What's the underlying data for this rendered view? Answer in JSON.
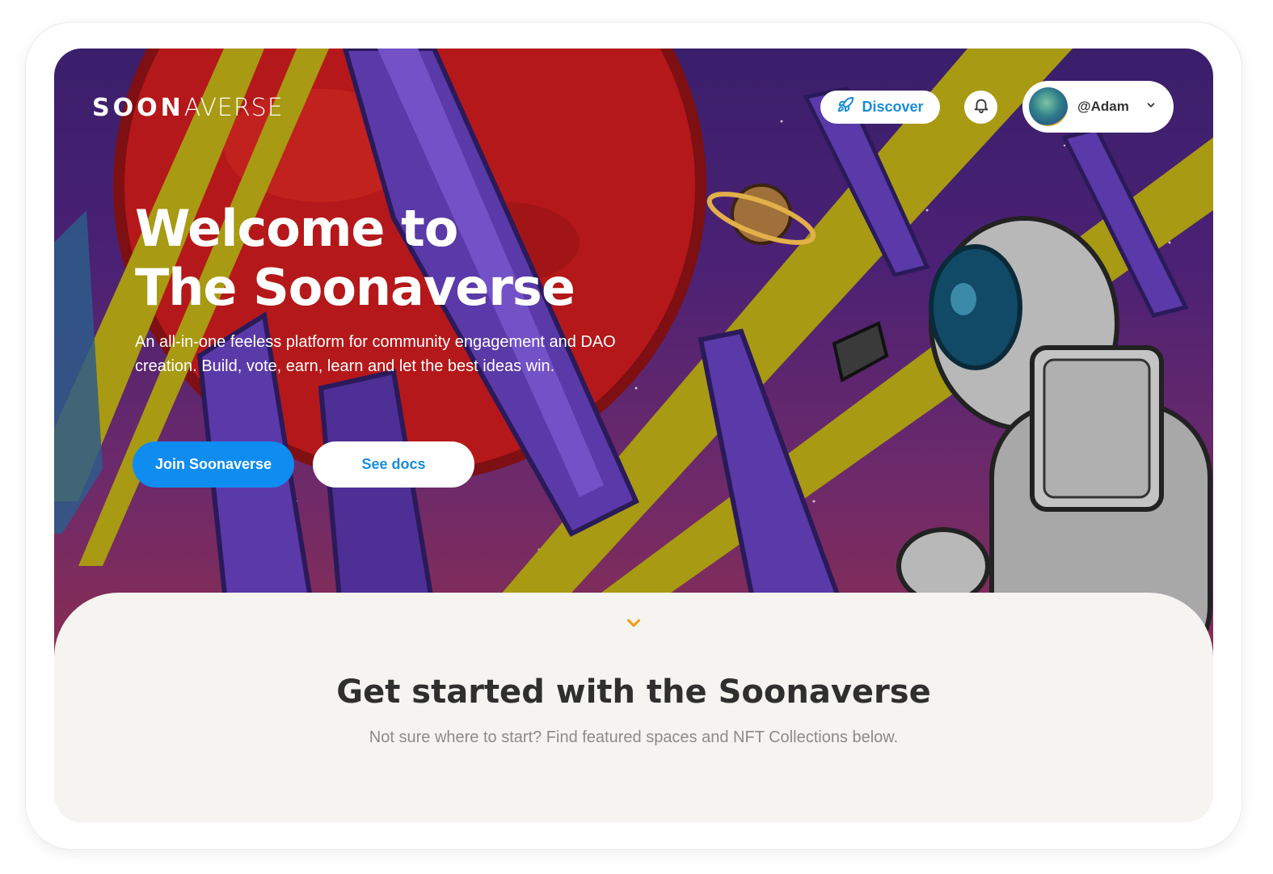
{
  "header": {
    "logo_bold": "SOON",
    "logo_thin": "AVERSE",
    "discover_label": "Discover",
    "username": "@Adam"
  },
  "hero": {
    "title_line1": "Welcome to",
    "title_line2": "The Soonaverse",
    "description": "An all-in-one feeless platform for community engagement and DAO creation. Build, vote, earn, learn and let the best ideas win.",
    "primary_button": "Join Soonaverse",
    "secondary_button": "See docs"
  },
  "section": {
    "title": "Get started with the Soonaverse",
    "subtitle": "Not sure where to start? Find featured spaces and NFT Collections below."
  },
  "icons": {
    "discover": "rocket-icon",
    "notifications": "bell-icon",
    "dropdown": "chevron-down-icon",
    "scroll": "chevron-down-icon"
  },
  "colors": {
    "accent_blue": "#0f8cf0",
    "link_blue": "#1a8cd8",
    "scroll_chevron": "#f0a020",
    "section_background": "#f5f4f0"
  }
}
